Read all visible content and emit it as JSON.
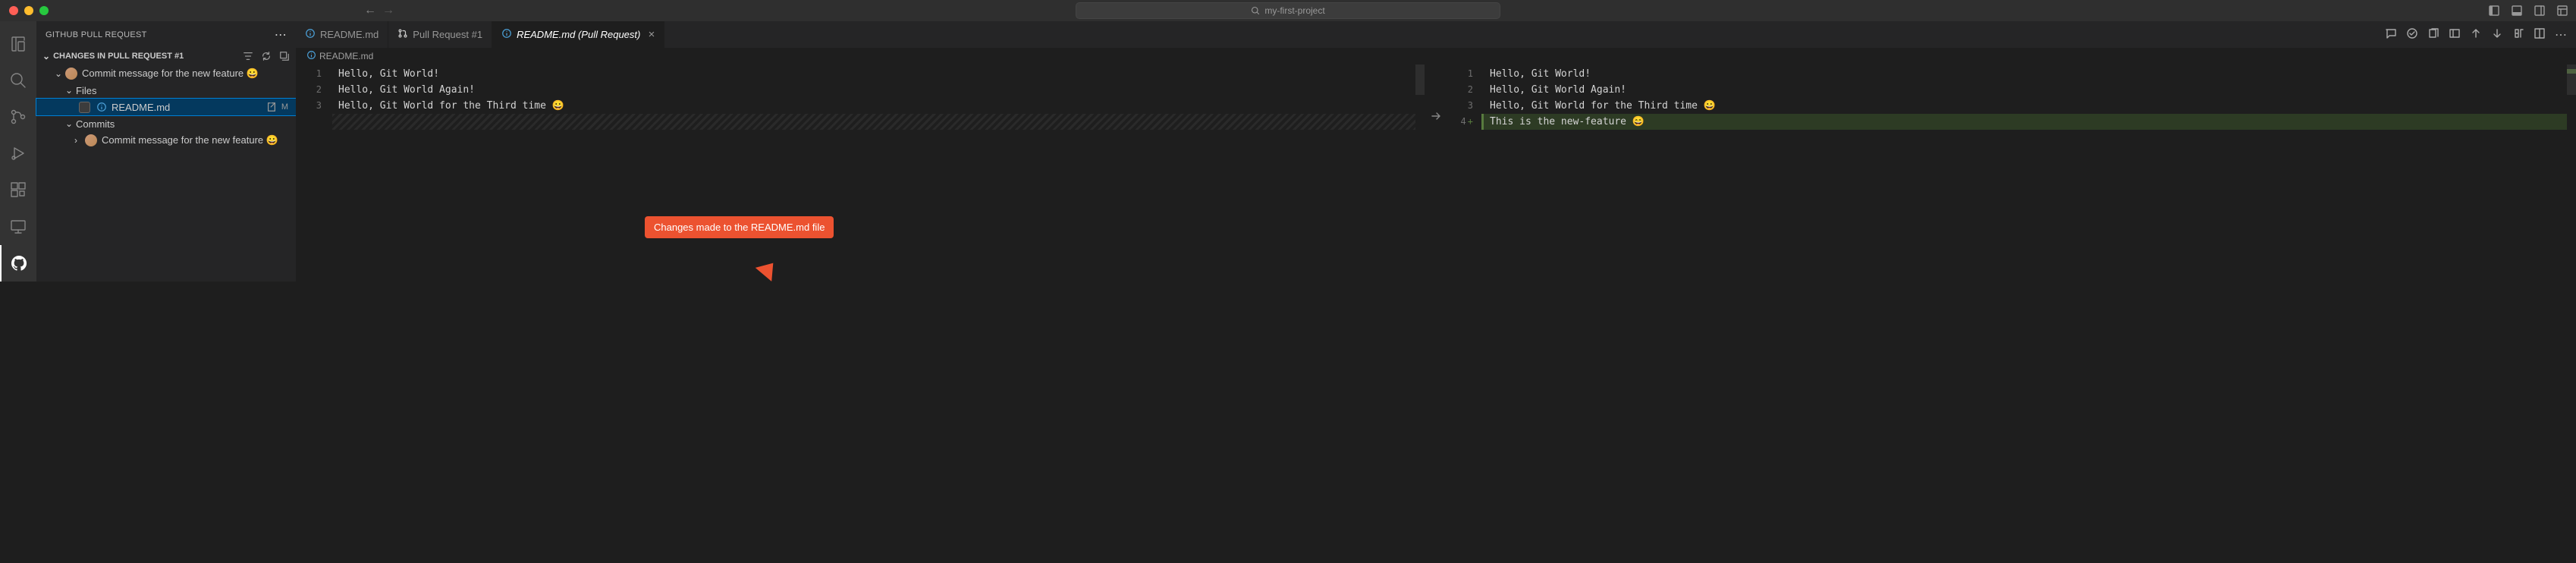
{
  "window": {
    "search_text": "my-first-project"
  },
  "sidebar": {
    "title": "GITHUB PULL REQUEST",
    "section_title": "CHANGES IN PULL REQUEST #1",
    "commit_row": {
      "label": "Commit message for the new feature 😀"
    },
    "files_label": "Files",
    "file_row": {
      "name": "README.md",
      "badge": "M"
    },
    "commits_label": "Commits",
    "commit_row_2": {
      "label": "Commit message for the new feature 😀"
    }
  },
  "tabs": [
    {
      "label": "README.md"
    },
    {
      "label": "Pull Request #1"
    },
    {
      "label": "README.md (Pull Request)"
    }
  ],
  "breadcrumb": {
    "file": "README.md"
  },
  "diff": {
    "left": {
      "lines": [
        {
          "n": "1",
          "text": "Hello, Git World!"
        },
        {
          "n": "2",
          "text": "Hello, Git World Again!"
        },
        {
          "n": "3",
          "text": "Hello, Git World for the Third time 😀"
        }
      ],
      "hatch": true
    },
    "right": {
      "lines": [
        {
          "n": "1",
          "text": "Hello, Git World!"
        },
        {
          "n": "2",
          "text": "Hello, Git World Again!"
        },
        {
          "n": "3",
          "text": "Hello, Git World for the Third time 😀"
        },
        {
          "n": "4",
          "text": "This is the new-feature 😄",
          "added": true
        }
      ]
    }
  },
  "callout": "Changes made to the README.md file"
}
